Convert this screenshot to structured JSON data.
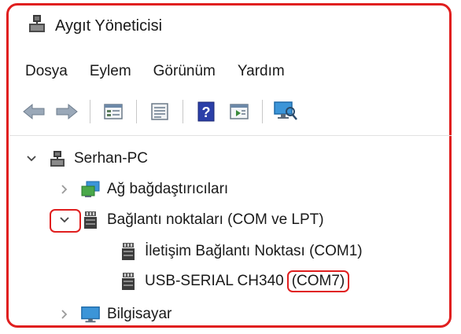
{
  "window": {
    "title": "Aygıt Yöneticisi",
    "icon": "device-manager-icon"
  },
  "menu": [
    "Dosya",
    "Eylem",
    "Görünüm",
    "Yardım"
  ],
  "toolbar": {
    "buttons": [
      "back-arrow-icon",
      "forward-arrow-icon",
      "properties-icon",
      "details-view-icon",
      "help-icon",
      "driver-update-icon",
      "scan-hardware-icon"
    ]
  },
  "tree": {
    "root": {
      "label": "Serhan-PC",
      "icon": "computer-tree-icon",
      "expanded": true
    },
    "network": {
      "label": "Ağ bağdaştırıcıları",
      "icon": "network-adapter-icon",
      "expanded": false
    },
    "ports": {
      "label": "Bağlantı noktaları (COM ve LPT)",
      "icon": "port-icon",
      "expanded": true
    },
    "port1": {
      "label": "İletişim Bağlantı Noktası (COM1)",
      "icon": "port-icon"
    },
    "port2": {
      "label_prefix": "USB-SERIAL CH340",
      "label_com": "(COM7)",
      "icon": "port-icon"
    },
    "computer": {
      "label": "Bilgisayar",
      "icon": "monitor-icon",
      "expanded": false
    }
  },
  "colors": {
    "highlight": "#e01f1f",
    "accent": "#2a7fd4"
  }
}
